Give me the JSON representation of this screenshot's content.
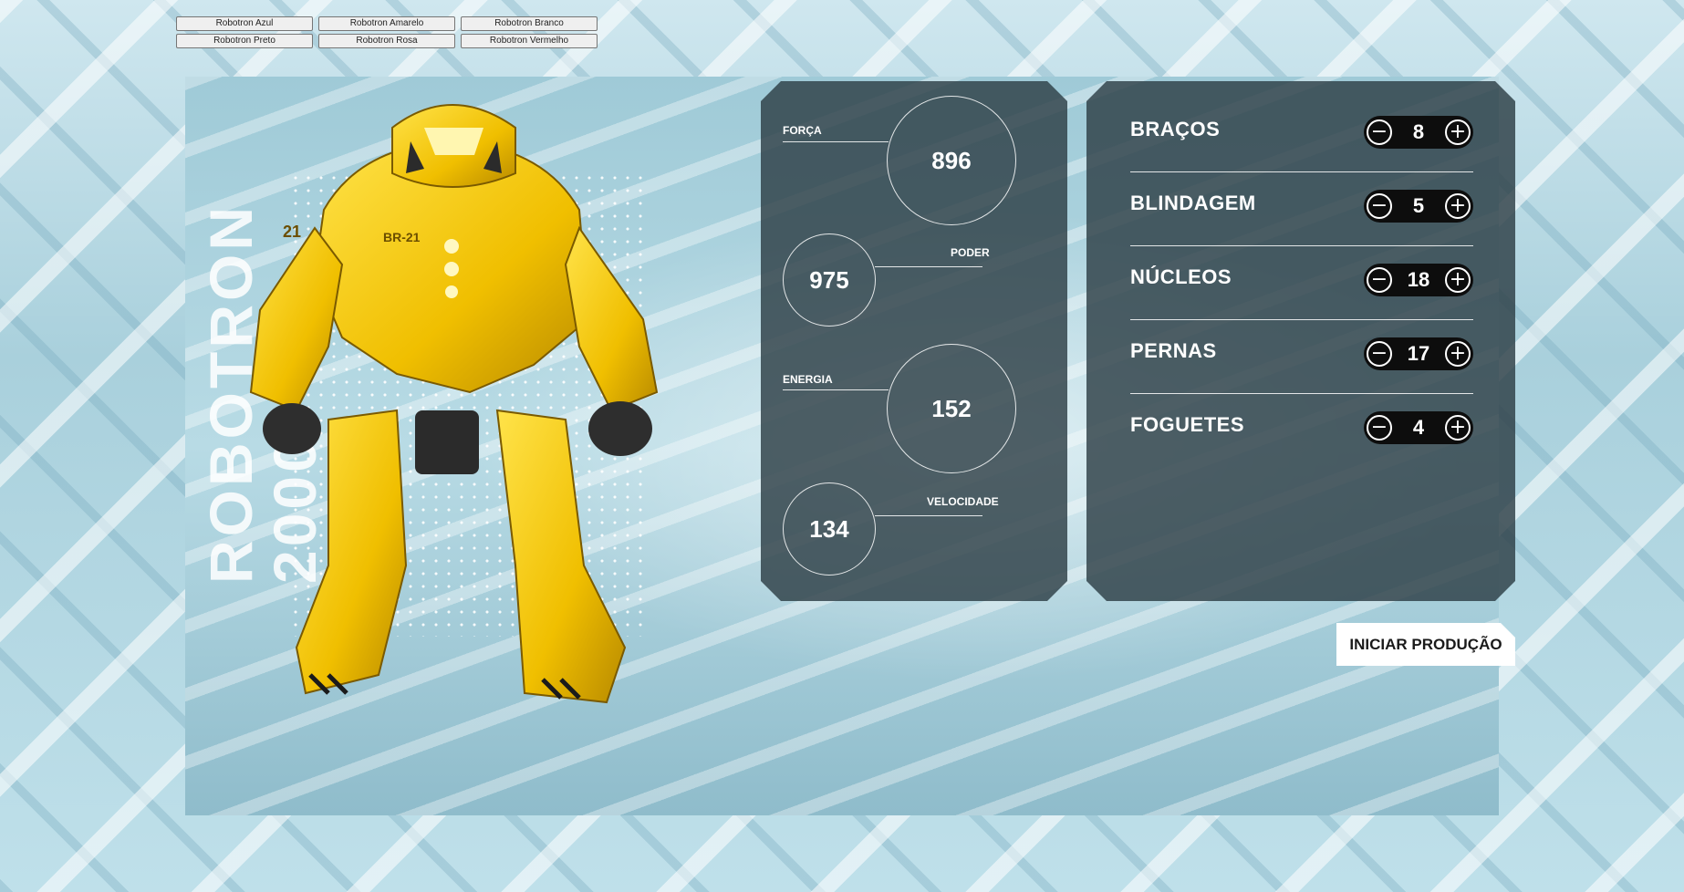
{
  "robot_selector": [
    "Robotron Azul",
    "Robotron Amarelo",
    "Robotron Branco",
    "Robotron Preto",
    "Robotron Rosa",
    "Robotron Vermelho"
  ],
  "title": {
    "line1": "ROBOTRON",
    "line2": "2000"
  },
  "robot_badges": {
    "chest": "BR-21",
    "shoulder": "21"
  },
  "stats": {
    "forca": {
      "label": "FORÇA",
      "value": "896"
    },
    "poder": {
      "label": "PODER",
      "value": "975"
    },
    "energia": {
      "label": "ENERGIA",
      "value": "152"
    },
    "velocidade": {
      "label": "VELOCIDADE",
      "value": "134"
    }
  },
  "parts": [
    {
      "name": "BRAÇOS",
      "value": "8"
    },
    {
      "name": "BLINDAGEM",
      "value": "5"
    },
    {
      "name": "NÚCLEOS",
      "value": "18"
    },
    {
      "name": "PERNAS",
      "value": "17"
    },
    {
      "name": "FOGUETES",
      "value": "4"
    }
  ],
  "controls": {
    "minus": "−",
    "plus": "+"
  },
  "start_button": "INICIAR PRODUÇÃO",
  "colors": {
    "panel": "#2d3e46",
    "robot": "#f2c500",
    "counter": "#0d0d0d"
  }
}
